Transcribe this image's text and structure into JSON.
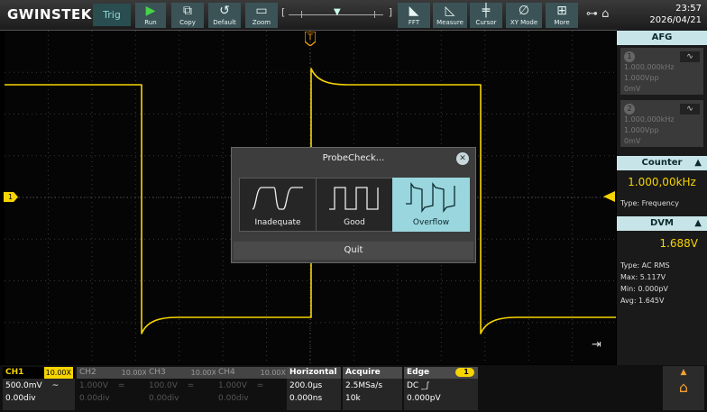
{
  "brand": "GWINSTEK",
  "status": {
    "trigger_label": "Trig"
  },
  "toolbar": [
    {
      "id": "run",
      "label": "Run",
      "icon": "play-icon"
    },
    {
      "id": "copy",
      "label": "Copy",
      "icon": "copy-icon"
    },
    {
      "id": "default",
      "label": "Default",
      "icon": "reset-icon"
    },
    {
      "id": "zoom",
      "label": "Zoom",
      "icon": "zoom-icon"
    },
    {
      "id": "fft",
      "label": "FFT",
      "icon": "fft-icon"
    },
    {
      "id": "measure",
      "label": "Measure",
      "icon": "measure-icon"
    },
    {
      "id": "cursor",
      "label": "Cursor",
      "icon": "cursor-icon"
    },
    {
      "id": "xymode",
      "label": "XY Mode",
      "icon": "xy-icon"
    },
    {
      "id": "more",
      "label": "More",
      "icon": "more-icon"
    }
  ],
  "clock": {
    "time": "23:57",
    "date": "2026/04/21"
  },
  "afg": {
    "title": "AFG",
    "ch1": {
      "num": "1",
      "freq": "1.000,000kHz",
      "amp": "1.000Vpp",
      "offset": "0mV"
    },
    "ch2": {
      "num": "2",
      "freq": "1.000,000kHz",
      "amp": "1.000Vpp",
      "offset": "0mV"
    }
  },
  "counter": {
    "title": "Counter",
    "value": "1.000,00kHz",
    "type": "Type: Frequency"
  },
  "dvm": {
    "title": "DVM",
    "value": "1.688V",
    "type": "Type: AC RMS",
    "max": "Max: 5.117V",
    "min": "Min: 0.000pV",
    "avg": "Avg: 1.645V"
  },
  "channels": [
    {
      "name": "CH1",
      "probe": "10.00X",
      "scale": "500.0mV",
      "coupling": "~",
      "offset": "0.00div",
      "active": true
    },
    {
      "name": "CH2",
      "probe": "10.00X",
      "scale": "1.000V",
      "coupling": "=",
      "offset": "0.00div",
      "active": false
    },
    {
      "name": "CH3",
      "probe": "10.00X",
      "scale": "100.0V",
      "coupling": "=",
      "offset": "0.00div",
      "active": false
    },
    {
      "name": "CH4",
      "probe": "10.00X",
      "scale": "1.000V",
      "coupling": "=",
      "offset": "0.00div",
      "active": false
    }
  ],
  "horizontal": {
    "title": "Horizontal",
    "scale": "200.0µs",
    "position": "0.000ns"
  },
  "acquire": {
    "title": "Acquire",
    "rate": "2.5MSa/s",
    "length": "10k"
  },
  "trigger": {
    "title": "Edge",
    "source": "1",
    "coupling": "DC",
    "level": "0.000pV"
  },
  "dialog": {
    "title": "ProbeCheck...",
    "options": [
      "Inadequate",
      "Good",
      "Overflow"
    ],
    "selected": "Overflow",
    "quit_label": "Quit"
  },
  "markers": {
    "ch1": "1",
    "trigger_pos": "T"
  },
  "colors": {
    "ch1": "#f5d400",
    "accent": "#9ad6de",
    "panel_header": "#c7e5e8"
  }
}
